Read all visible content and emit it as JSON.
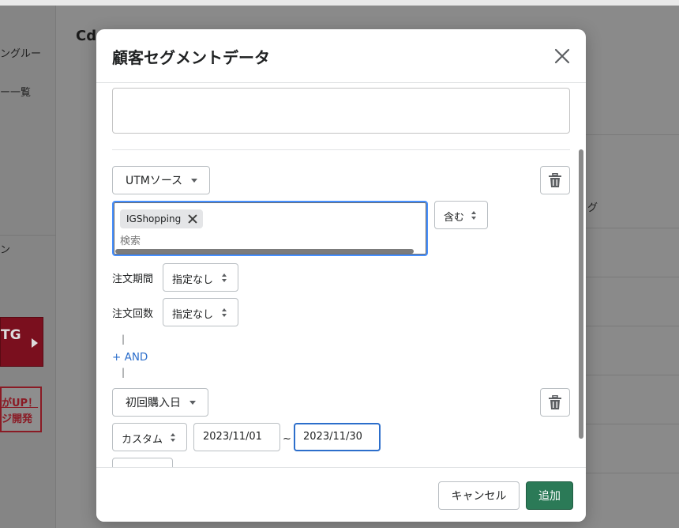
{
  "background": {
    "sidebar": {
      "item1": "ングルー",
      "item2": "ー一覧",
      "item3": "ン"
    },
    "banner1": {
      "text": "TG"
    },
    "banner2": {
      "line1": "がUP！",
      "line2": "ジ開発"
    },
    "main_title": "Cd",
    "right_column_text": "グ"
  },
  "modal": {
    "title": "顧客セグメントデータ",
    "close_icon": "close-icon",
    "condition1": {
      "field_label": "UTMソース",
      "tags": [
        "IGShopping"
      ],
      "search_placeholder": "検索",
      "operator_label": "含む",
      "order_period_label": "注文期間",
      "order_period_value": "指定なし",
      "order_count_label": "注文回数",
      "order_count_value": "指定なし"
    },
    "connector_top": "|",
    "and_label": "+ AND",
    "connector_bottom": "|",
    "condition2": {
      "field_label": "初回購入日",
      "range_type": "カスタム",
      "date_from": "2023/11/01",
      "tilde": "~",
      "date_to": "2023/11/30"
    },
    "footer": {
      "cancel_label": "キャンセル",
      "add_label": "追加"
    }
  },
  "colors": {
    "primary": "#2b7a57",
    "focus": "#458fff",
    "link": "#2c6ecb",
    "overlay": "#8a8a8a"
  }
}
